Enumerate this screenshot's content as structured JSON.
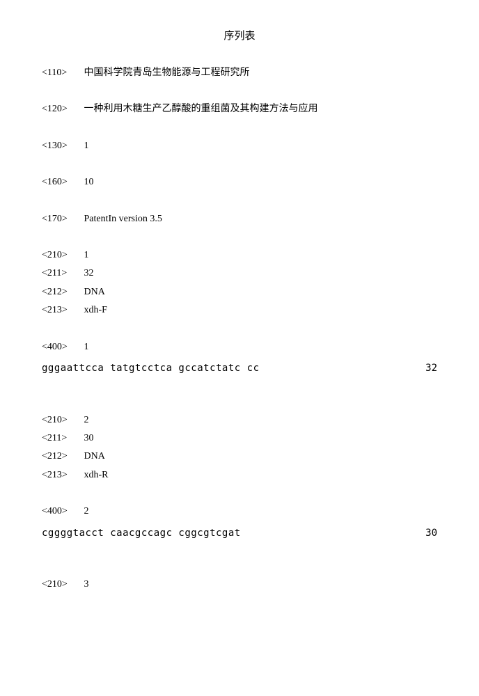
{
  "title": "序列表",
  "header": {
    "tag110": "<110>",
    "val110": "中国科学院青岛生物能源与工程研究所",
    "tag120": "<120>",
    "val120": "一种利用木糖生产乙醇酸的重组菌及其构建方法与应用",
    "tag130": "<130>",
    "val130": "1",
    "tag160": "<160>",
    "val160": "10",
    "tag170": "<170>",
    "val170": "PatentIn version 3.5"
  },
  "seq1": {
    "tag210": "<210>",
    "val210": "1",
    "tag211": "<211>",
    "val211": "32",
    "tag212": "<212>",
    "val212": "DNA",
    "tag213": "<213>",
    "val213": "xdh-F",
    "tag400": "<400>",
    "val400": "1",
    "sequence": "gggaattcca tatgtcctca gccatctatc cc",
    "length": "32"
  },
  "seq2": {
    "tag210": "<210>",
    "val210": "2",
    "tag211": "<211>",
    "val211": "30",
    "tag212": "<212>",
    "val212": "DNA",
    "tag213": "<213>",
    "val213": "xdh-R",
    "tag400": "<400>",
    "val400": "2",
    "sequence": "cggggtacct caacgccagc cggcgtcgat",
    "length": "30"
  },
  "seq3": {
    "tag210": "<210>",
    "val210": "3"
  }
}
